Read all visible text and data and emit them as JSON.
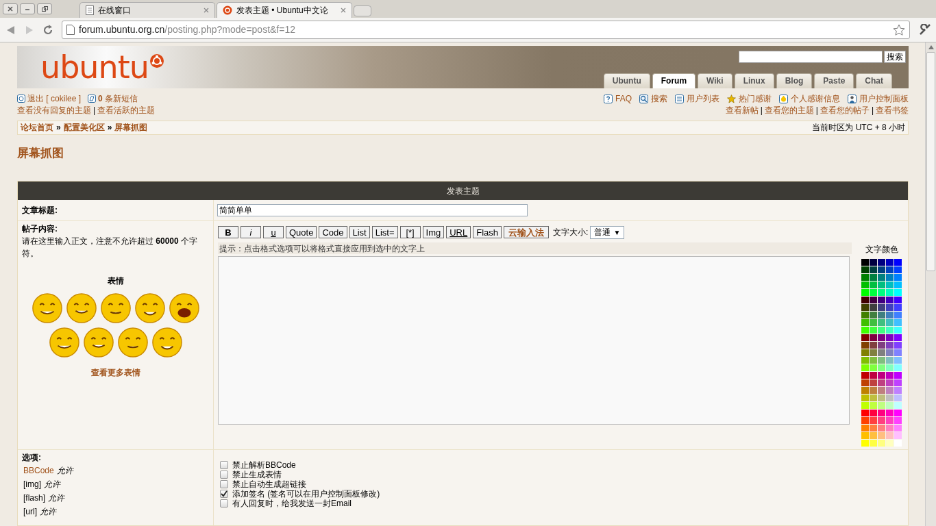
{
  "browser": {
    "tabs": [
      {
        "title": "在线窗口",
        "selected": false
      },
      {
        "title": "发表主题 • Ubuntu中文论",
        "selected": true
      }
    ],
    "address": {
      "host": "forum.ubuntu.org.cn",
      "path": "/posting.php?mode=post&f=12"
    }
  },
  "header": {
    "logo": "ubuntu",
    "search_button": "搜索",
    "nav": [
      {
        "label": "Ubuntu",
        "selected": false
      },
      {
        "label": "Forum",
        "selected": true
      },
      {
        "label": "Wiki",
        "selected": false
      },
      {
        "label": "Linux",
        "selected": false
      },
      {
        "label": "Blog",
        "selected": false
      },
      {
        "label": "Paste",
        "selected": false
      },
      {
        "label": "Chat",
        "selected": false
      }
    ]
  },
  "user_links": {
    "logout": "退出 [ cokilee ]",
    "messages": "**0** 条新短信",
    "views": [
      "查看没有回复的主题",
      "查看活跃的主题"
    ]
  },
  "tool_links": [
    {
      "label": "FAQ",
      "kind": "help"
    },
    {
      "label": "搜索",
      "kind": "search"
    },
    {
      "label": "用户列表",
      "kind": "list"
    },
    {
      "label": "热门感谢",
      "kind": "star"
    },
    {
      "label": "个人感谢信息",
      "kind": "thanks"
    },
    {
      "label": "用户控制面板",
      "kind": "user"
    }
  ],
  "view_links": [
    "查看新帖",
    "查看您的主题",
    "查看您的帖子",
    "查看书签"
  ],
  "link_separator": "|",
  "breadcrumb_separator": "»",
  "breadcrumb": [
    "论坛首页",
    "配置美化区",
    "屏幕抓图"
  ],
  "timezone": "当前时区为 UTC + 8 小时",
  "page_title": "屏幕抓图",
  "form": {
    "heading": "发表主题",
    "subject_label": "文章标题:",
    "subject_value": "简简单单",
    "body_label": "帖子内容:",
    "body_hint": "请在这里输入正文，注意不允许超过 **60000** 个字符。",
    "smileys_title": "表情",
    "more_smileys": "查看更多表情",
    "toolbar": [
      {
        "label": "B",
        "kind": "bold"
      },
      {
        "label": "i",
        "kind": "italic"
      },
      {
        "label": "u",
        "kind": "underline"
      },
      {
        "label": "Quote",
        "kind": "plain"
      },
      {
        "label": "Code",
        "kind": "plain"
      },
      {
        "label": "List",
        "kind": "plain"
      },
      {
        "label": "List=",
        "kind": "plain"
      },
      {
        "label": "[*]",
        "kind": "plain"
      },
      {
        "label": "Img",
        "kind": "plain"
      },
      {
        "label": "URL",
        "kind": "underline"
      },
      {
        "label": "Flash",
        "kind": "plain"
      },
      {
        "label": "云输入法",
        "kind": "accent"
      }
    ],
    "font_size_label": "文字大小:",
    "font_size_value": "普通",
    "font_size_caret": "▼",
    "tip": "提示：点击格式选项可以将格式直接应用到选中的文字上",
    "color_label": "文字颜色",
    "options_label": "选项:",
    "option_status": [
      {
        "name": "BBCode",
        "value": "允许",
        "link": true
      },
      {
        "name": "[img]",
        "value": "允许",
        "link": false
      },
      {
        "name": "[flash]",
        "value": "允许",
        "link": false
      },
      {
        "name": "[url]",
        "value": "允许",
        "link": false
      }
    ],
    "checkboxes": [
      {
        "label": "禁止解析BBCode",
        "checked": false
      },
      {
        "label": "禁止生成表情",
        "checked": false
      },
      {
        "label": "禁止自动生成超链接",
        "checked": false
      },
      {
        "label": "添加签名 (签名可以在用户控制面板修改)",
        "checked": true
      },
      {
        "label": "有人回复时，给我发送一封Email",
        "checked": false
      }
    ]
  }
}
